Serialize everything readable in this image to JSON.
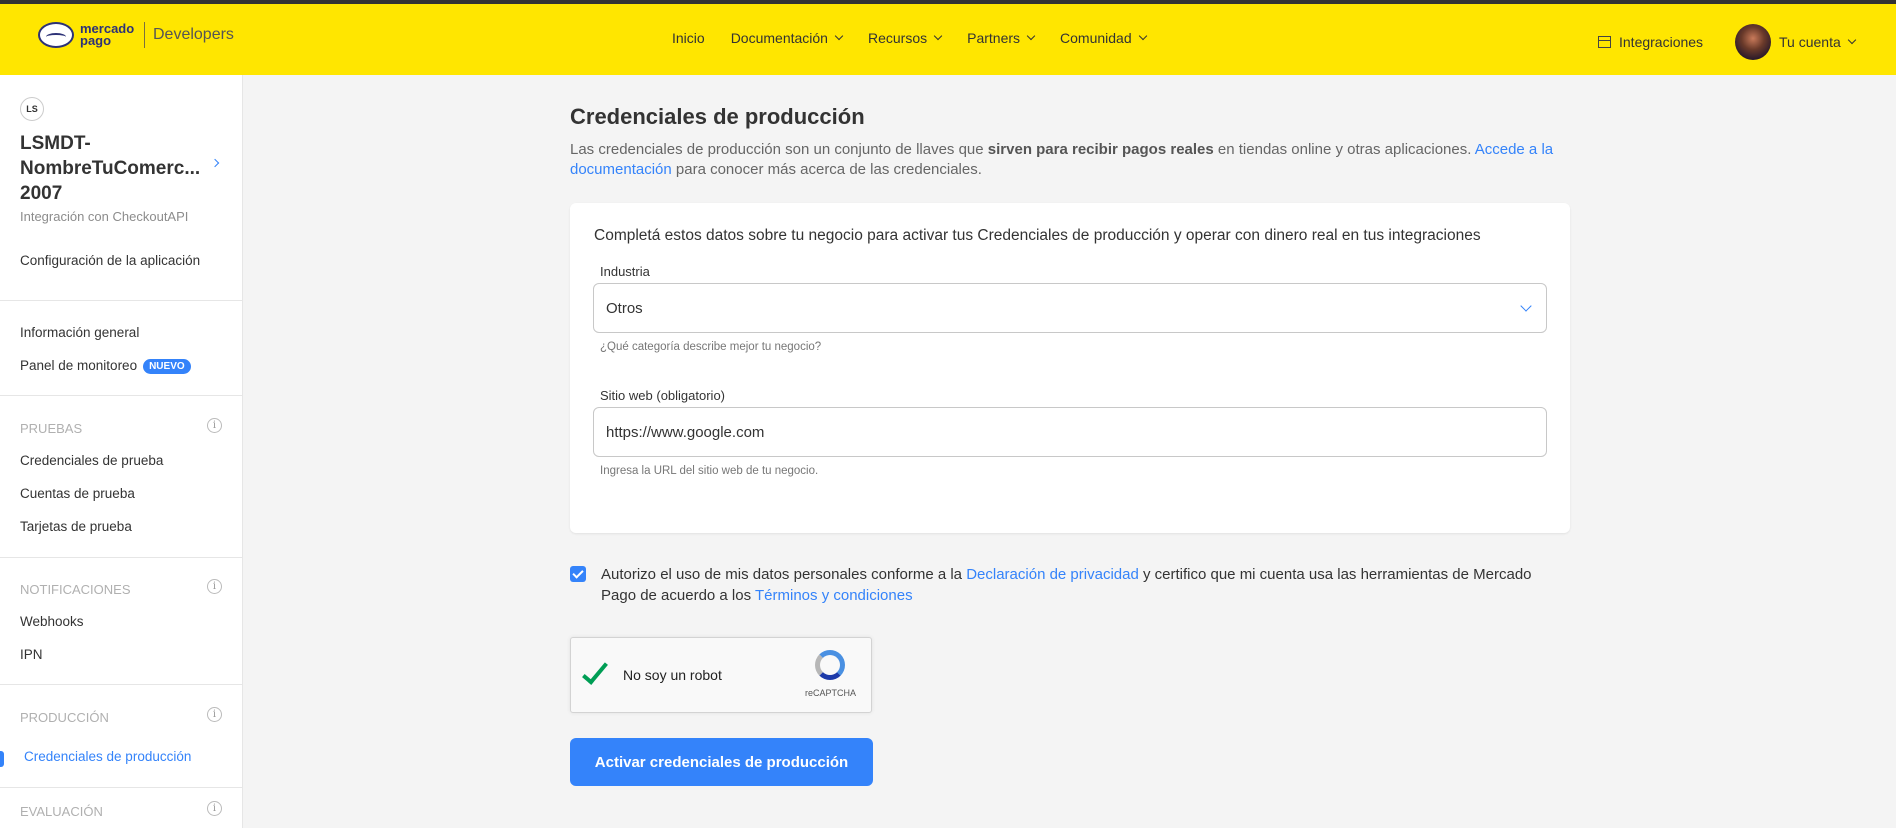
{
  "header": {
    "logo_text": "mercado pago",
    "logo_suffix": "Developers",
    "nav": [
      {
        "label": "Inicio"
      },
      {
        "label": "Documentación"
      },
      {
        "label": "Recursos"
      },
      {
        "label": "Partners"
      },
      {
        "label": "Comunidad"
      }
    ],
    "integrations_label": "Integraciones",
    "account_label": "Tu cuenta"
  },
  "sidebar": {
    "app_initials": "LS",
    "app_name": "LSMDT-NombreTuComerc... 2007",
    "app_subtitle": "Integración con CheckoutAPI",
    "config_link": "Configuración de la aplicación",
    "general_info": "Información general",
    "monitor_panel": "Panel de monitoreo",
    "new_badge": "NUEVO",
    "sections": {
      "pruebas": {
        "title": "PRUEBAS",
        "items": [
          "Credenciales de prueba",
          "Cuentas de prueba",
          "Tarjetas de prueba"
        ]
      },
      "notificaciones": {
        "title": "NOTIFICACIONES",
        "items": [
          "Webhooks",
          "IPN"
        ]
      },
      "produccion": {
        "title": "PRODUCCIÓN",
        "items": [
          "Credenciales de producción"
        ]
      },
      "evaluacion": {
        "title": "EVALUACIÓN"
      }
    }
  },
  "main": {
    "title": "Credenciales de producción",
    "desc_part1": "Las credenciales de producción son un conjunto de llaves que ",
    "desc_bold": "sirven para recibir pagos reales",
    "desc_part2": " en tiendas online y otras aplicaciones. ",
    "desc_link": "Accede a la documentación",
    "desc_part3": " para conocer más acerca de las credenciales.",
    "card_intro": "Completá estos datos sobre tu negocio para activar tus Credenciales de producción y operar con dinero real en tus integraciones",
    "industry_label": "Industria",
    "industry_value": "Otros",
    "industry_help": "¿Qué categoría describe mejor tu negocio?",
    "website_label": "Sitio web (obligatorio)",
    "website_value": "https://www.google.com",
    "website_help": "Ingresa la URL del sitio web de tu negocio.",
    "consent_checked": true,
    "consent_part1": "Autorizo el uso de mis datos personales conforme a la ",
    "consent_link1": "Declaración de privacidad",
    "consent_part2": " y certifico que mi cuenta usa las herramientas de Mercado Pago de acuerdo a los ",
    "consent_link2": "Términos y condiciones",
    "recaptcha_label": "No soy un robot",
    "recaptcha_brand": "reCAPTCHA",
    "cta_label": "Activar credenciales de producción"
  },
  "colors": {
    "header_bg": "#ffe600",
    "accent": "#3483fa",
    "page_bg": "#f4f4f4"
  }
}
